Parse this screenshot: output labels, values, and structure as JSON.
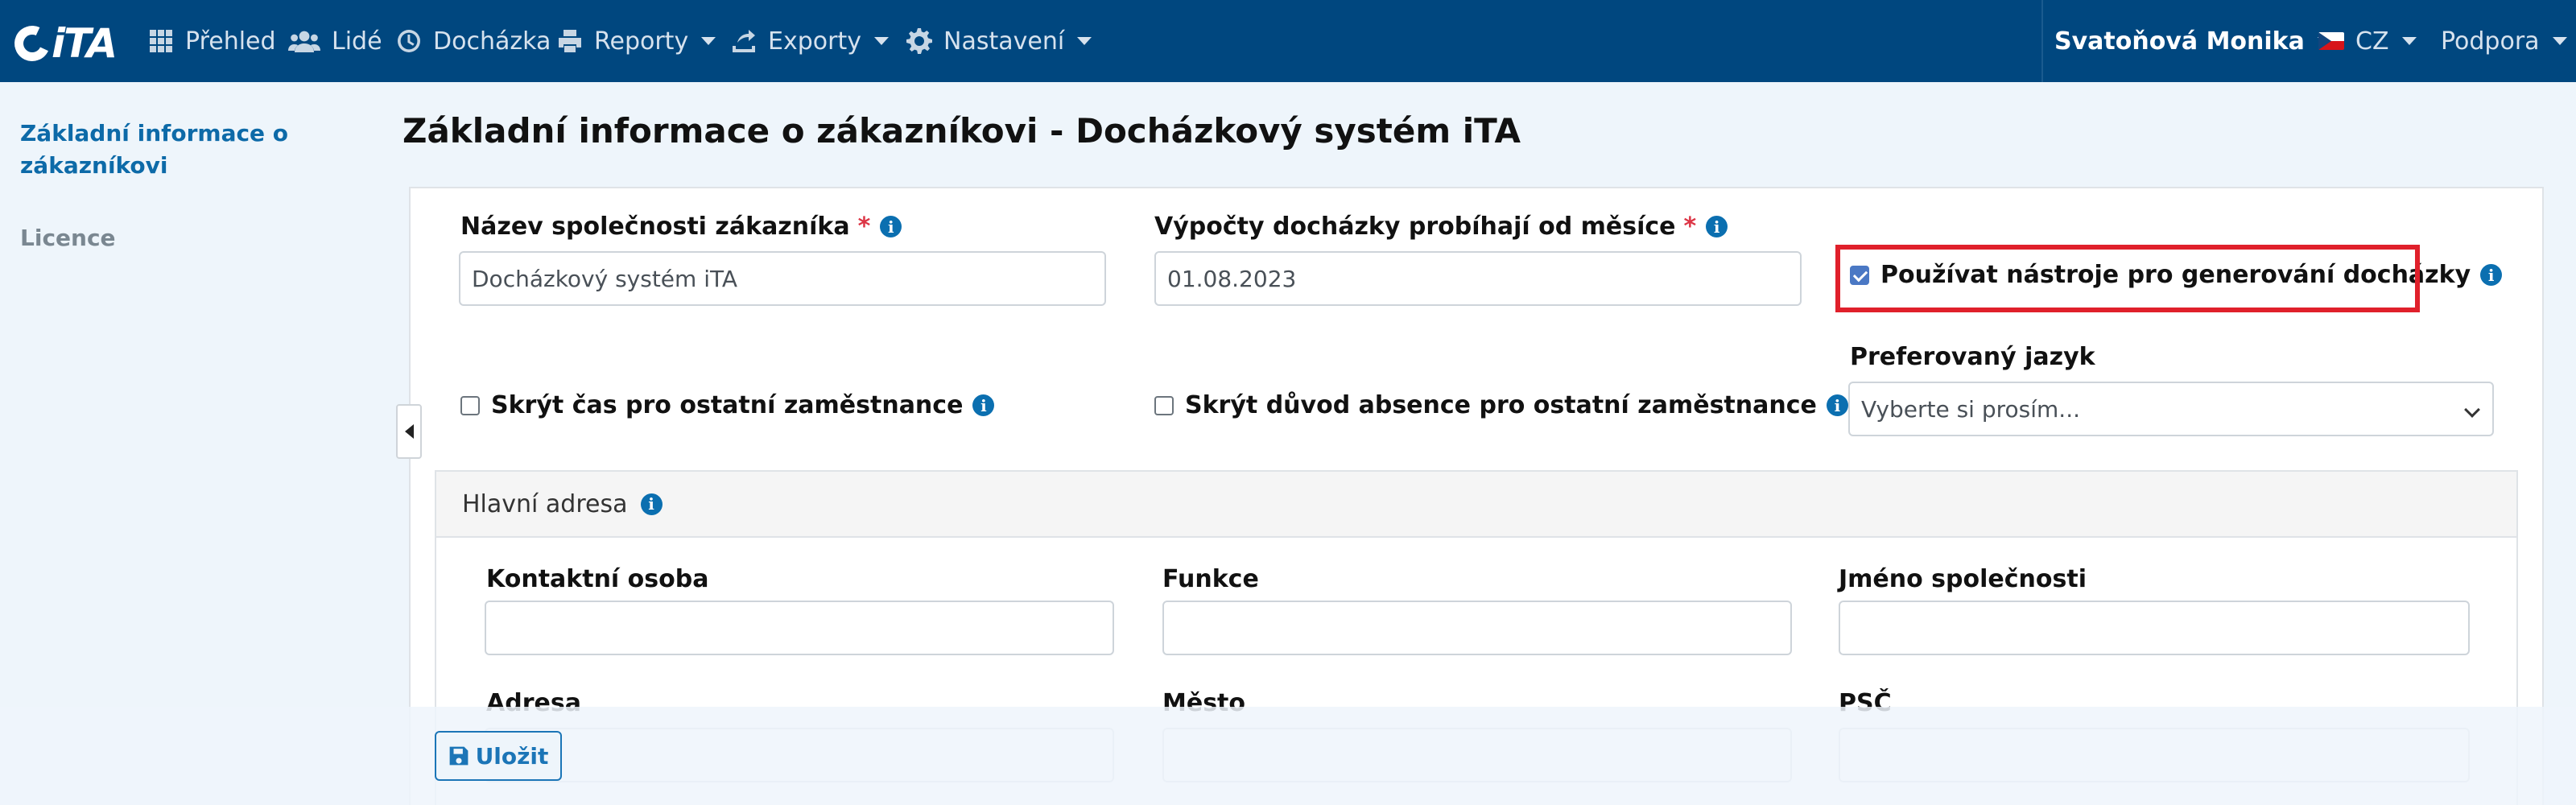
{
  "navbar": {
    "logo_text": "iTA",
    "items": [
      {
        "label": "Přehled",
        "icon": "grid-icon"
      },
      {
        "label": "Lidé",
        "icon": "users-icon"
      },
      {
        "label": "Docházka",
        "icon": "clock-icon"
      },
      {
        "label": "Reporty",
        "icon": "printer-icon"
      },
      {
        "label": "Exporty",
        "icon": "export-icon"
      },
      {
        "label": "Nastavení",
        "icon": "gear-icon"
      }
    ],
    "user_name": "Svatoňová Monika",
    "language": "CZ",
    "support": "Podpora",
    "colors": {
      "background": "#00477f"
    }
  },
  "sidebar": {
    "items": [
      {
        "label": "Základní informace o zákazníkovi",
        "active": true
      },
      {
        "label": "Licence",
        "active": false
      }
    ]
  },
  "main": {
    "title": "Základní informace o zákazníkovi - Docházkový systém iTA",
    "company_name": {
      "label": "Název společnosti zákazníka",
      "required_mark": "*",
      "value": "Docházkový systém iTA"
    },
    "calc_from": {
      "label": "Výpočty docházky probíhají od měsíce",
      "required_mark": "*",
      "value": "01.08.2023"
    },
    "use_tools": {
      "label": "Používat nástroje pro generování docházky",
      "checked": true
    },
    "hide_time": {
      "label": "Skrýt čas pro ostatní zaměstnance",
      "checked": false
    },
    "hide_absence": {
      "label": "Skrýt důvod absence pro ostatní zaměstnance",
      "checked": false
    },
    "preferred_language": {
      "label": "Preferovaný jazyk",
      "placeholder": "Vyberte si prosím..."
    },
    "address_section": {
      "title": "Hlavní adresa",
      "contact_person": {
        "label": "Kontaktní osoba",
        "value": ""
      },
      "function": {
        "label": "Funkce",
        "value": ""
      },
      "company": {
        "label": "Jméno společnosti",
        "value": ""
      },
      "address": {
        "label": "Adresa"
      },
      "city": {
        "label": "Město"
      },
      "zip": {
        "label": "PSČ"
      }
    },
    "save_label": "Uložit",
    "colors": {
      "highlight": "#e0202b",
      "link": "#0d6aa8",
      "required": "#dc3545"
    }
  }
}
